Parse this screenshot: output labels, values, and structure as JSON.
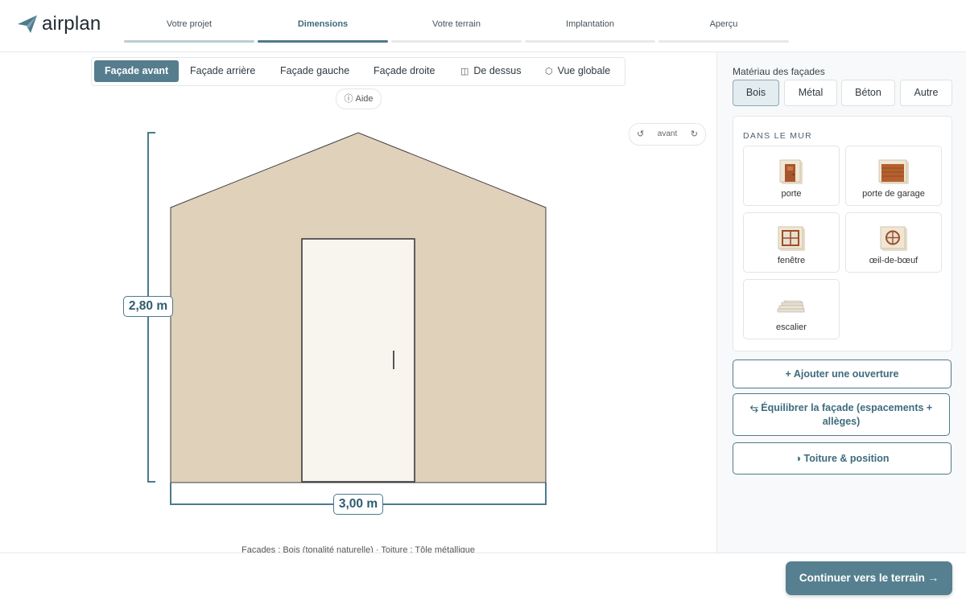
{
  "brand": {
    "name": "airplan"
  },
  "steps": [
    {
      "label": "Votre projet",
      "state": "done"
    },
    {
      "label": "Dimensions",
      "state": "active"
    },
    {
      "label": "Votre terrain",
      "state": "todo"
    },
    {
      "label": "Implantation",
      "state": "todo"
    },
    {
      "label": "Aperçu",
      "state": "todo"
    }
  ],
  "view_tabs": {
    "front": "Façade avant",
    "back": "Façade arrière",
    "left": "Façade gauche",
    "right": "Façade droite",
    "top": "De dessus",
    "global": "Vue globale",
    "active": "front"
  },
  "help_label": "Aide",
  "rotation": {
    "label": "avant"
  },
  "facade": {
    "height_label": "2,80 m",
    "width_label": "3,00 m",
    "wall_color": "#e0d1bb",
    "door_color": "#f8f5ee",
    "dimension_color": "#4a7a8c"
  },
  "footer_note": "Façades : Bois (tonalité naturelle) · Toiture : Tôle métallique",
  "sidebar": {
    "materials_title": "Matériau des façades",
    "materials": [
      {
        "label": "Bois",
        "active": true
      },
      {
        "label": "Métal",
        "active": false
      },
      {
        "label": "Béton",
        "active": false
      },
      {
        "label": "Autre",
        "active": false
      }
    ],
    "wall_title": "DANS LE MUR",
    "openings": [
      {
        "label": "porte",
        "icon": "door-icon"
      },
      {
        "label": "porte de garage",
        "icon": "garage-door-icon"
      },
      {
        "label": "fenêtre",
        "icon": "window-icon"
      },
      {
        "label": "œil-de-bœuf",
        "icon": "round-window-icon"
      },
      {
        "label": "escalier",
        "icon": "stairs-icon"
      }
    ],
    "actions": {
      "add_opening": "+ Ajouter une ouverture",
      "balance": "Équilibrer la façade (espacements + allèges)",
      "roof": "Toiture & position"
    }
  },
  "cta": "Continuer vers le terrain →"
}
